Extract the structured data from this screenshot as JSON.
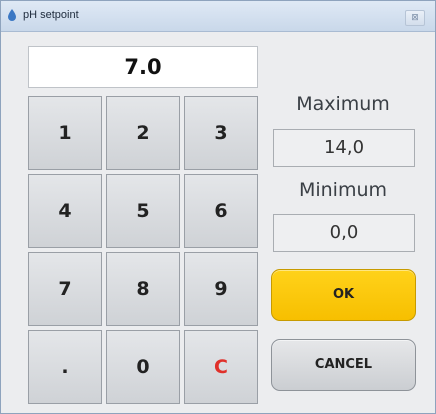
{
  "window": {
    "title": "pH setpoint",
    "close_glyph": "⊠",
    "icon": "app-drop-icon"
  },
  "display": {
    "value": "7.0"
  },
  "keypad": {
    "keys": [
      "1",
      "2",
      "3",
      "4",
      "5",
      "6",
      "7",
      "8",
      "9",
      ".",
      "0",
      "C"
    ]
  },
  "limits": {
    "maximum_label": "Maximum",
    "maximum_value": "14,0",
    "minimum_label": "Minimum",
    "minimum_value": "0,0"
  },
  "buttons": {
    "ok_label": "OK",
    "cancel_label": "CANCEL"
  },
  "colors": {
    "ok_yellow": "#f9c400",
    "clear_red": "#e0302a"
  }
}
